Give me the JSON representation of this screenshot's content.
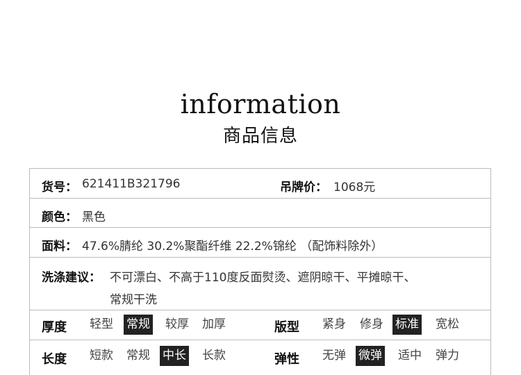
{
  "header": {
    "title_en": "information",
    "title_cn": "商品信息"
  },
  "specs": {
    "code_label": "货号：",
    "code_value": "621411B321796",
    "price_label": "吊牌价：",
    "price_value": "1068元",
    "color_label": "颜色：",
    "color_value": "黑色",
    "fabric_label": "面料：",
    "fabric_value": "47.6%腈纶 30.2%聚酯纤维 22.2%锦纶 （配饰料除外）",
    "wash_label": "洗涤建议：",
    "wash_line1": "不可漂白、不高于110度反面熨烫、遮阴晾干、平摊晾干、",
    "wash_line2": "常规干洗"
  },
  "attributes": {
    "thickness": {
      "label": "厚度",
      "options": [
        "轻型",
        "常规",
        "较厚",
        "加厚"
      ],
      "selected": "常规"
    },
    "fit": {
      "label": "版型",
      "options": [
        "紧身",
        "修身",
        "标准",
        "宽松"
      ],
      "selected": "标准"
    },
    "length": {
      "label": "长度",
      "options": [
        "短款",
        "常规",
        "中长",
        "长款"
      ],
      "selected": "中长"
    },
    "elasticity": {
      "label": "弹性",
      "options": [
        "无弹",
        "微弹",
        "适中",
        "弹力"
      ],
      "selected": "微弹"
    }
  },
  "colors": {
    "selected_bg": "#222222",
    "border": "#bbbbbb"
  }
}
